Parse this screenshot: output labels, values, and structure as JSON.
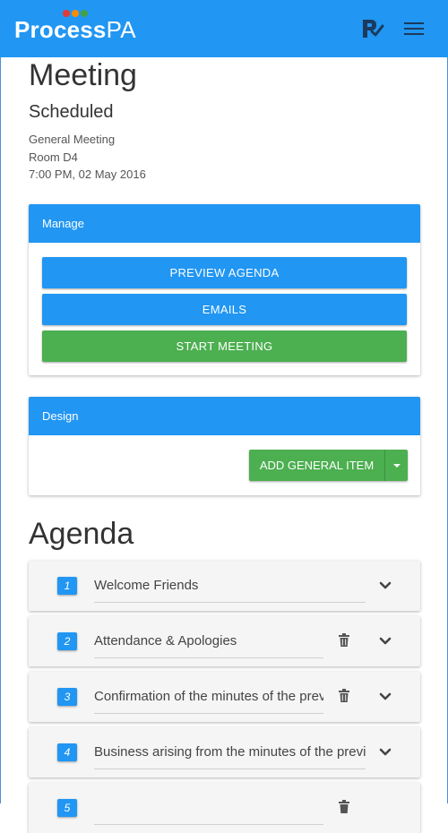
{
  "app": {
    "logo_bold": "Process",
    "logo_light": "PA",
    "dot_colors": [
      "#e53935",
      "#fb8c00",
      "#43a047"
    ],
    "accent": "#2196f3",
    "success": "#4caf50",
    "icons": {
      "brand": "process-pa-check-icon",
      "menu": "hamburger-menu-icon"
    }
  },
  "meeting": {
    "heading": "Meeting",
    "status": "Scheduled",
    "type": "General Meeting",
    "room": "Room D4",
    "datetime": "7:00 PM, 02 May 2016"
  },
  "manage": {
    "title": "Manage",
    "preview_label": "PREVIEW AGENDA",
    "emails_label": "EMAILS",
    "start_label": "START MEETING"
  },
  "design": {
    "title": "Design",
    "add_label": "ADD GENERAL ITEM"
  },
  "agenda": {
    "heading": "Agenda",
    "items": [
      {
        "number": "1",
        "title": "Welcome Friends",
        "deletable": false
      },
      {
        "number": "2",
        "title": "Attendance & Apologies",
        "deletable": true
      },
      {
        "number": "3",
        "title": "Confirmation of the minutes of the previous meeting",
        "deletable": true
      },
      {
        "number": "4",
        "title": "Business arising from the minutes of the previous meeting",
        "deletable": false
      },
      {
        "number": "5",
        "title": "",
        "deletable": true
      }
    ]
  }
}
